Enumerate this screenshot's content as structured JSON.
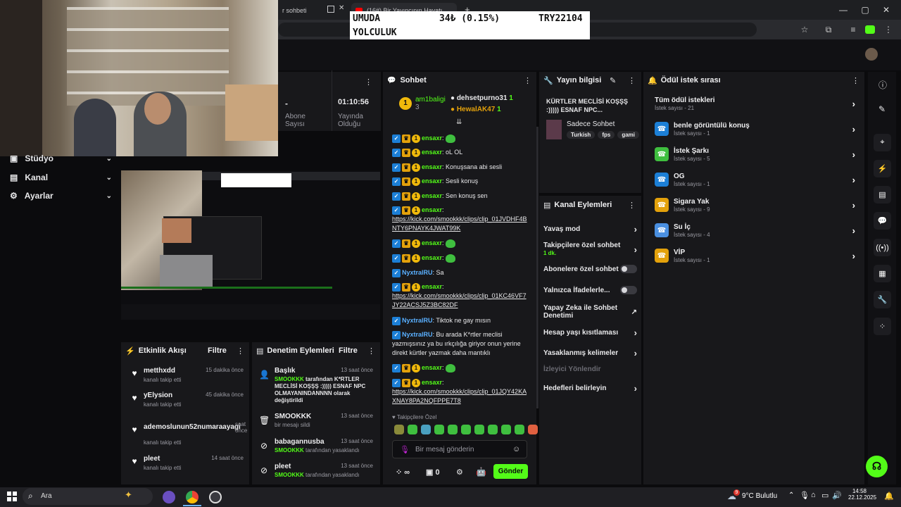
{
  "browser": {
    "tab1_title": "r sohbeti",
    "tab2_title": "(16#) Bir Yayıncının Hayatı",
    "new_tab": "+",
    "min": "—",
    "max": "▢",
    "close": "✕"
  },
  "ticker": {
    "name_line1": "UMUDA",
    "name_line2": "YOLCULUK",
    "change": "34₺ (0.15%)",
    "price": "TRY22104"
  },
  "stats": {
    "subs_value": "-",
    "subs_label_1": "Abone",
    "subs_label_2": "Sayısı",
    "uptime_value": "01:10:56",
    "uptime_label_1": "Yayında",
    "uptime_label_2": "Olduğu"
  },
  "nav": {
    "items": [
      {
        "label": "Stüdyo"
      },
      {
        "label": "Kanal"
      },
      {
        "label": "Ayarlar"
      }
    ]
  },
  "chat": {
    "title": "Sohbet",
    "top": {
      "user1": "am1baligi",
      "user1_count": "3",
      "user2": "dehsetpurno31",
      "user2_count": "1",
      "user3": "HewalAK47",
      "user3_count": "1",
      "rank": "1"
    },
    "lines": [
      {
        "user": "ensaxr",
        "text": ""
      },
      {
        "user": "ensaxr",
        "text": "oL OL"
      },
      {
        "user": "ensaxr",
        "text": "Konuşsana abi sesli"
      },
      {
        "user": "ensaxr",
        "text": "Sesli konuş"
      },
      {
        "user": "ensaxr",
        "text": "Sen konuş sen"
      },
      {
        "user": "ensaxr",
        "text": "https://kick.com/smookkk/clips/clip_01JVDHF4BNTY6PNAYK4JWAT99K"
      },
      {
        "user": "ensaxr",
        "text": ""
      },
      {
        "user": "ensaxr",
        "text": ""
      },
      {
        "user": "NyxtralRU",
        "text": "Sa"
      },
      {
        "user": "ensaxr",
        "text": "https://kick.com/smookkk/clips/clip_01KC46VF7JY22ACSJ5Z3BC82DF"
      },
      {
        "user": "NyxtralRU",
        "text": "Tiktok ne gay mısın"
      },
      {
        "user": "NyxtralRU",
        "text": "Bu arada K*rtler meclisi yazmışsınız ya bu ırkçılığa giriyor onun yerine direkt kürtler yazmak daha mantıklı"
      },
      {
        "user": "ensaxr",
        "text": ""
      },
      {
        "user": "ensaxr",
        "text": "https://kick.com/smookkk/clips/clip_01JQY42KAXNAY8PA2NQFPPE7T8"
      }
    ],
    "followers_only": "Takipçilere Özel",
    "input_placeholder": "Bir mesaj gönderin",
    "infinity": "∞",
    "count": "0",
    "send": "Gönder"
  },
  "stream_info": {
    "title": "Yayın bilgisi",
    "stream_title": "KÜRTLER MECLİSİ KOŞŞŞ :))))) ESNAF NPC...",
    "category": "Sadece Sohbet",
    "tags": [
      "Turkish",
      "fps",
      "gami"
    ]
  },
  "channel_actions": {
    "title": "Kanal Eylemleri",
    "items": [
      {
        "label": "Yavaş mod",
        "control": "chevron"
      },
      {
        "label": "Takipçilere özel sohbet",
        "sub": "1 dk.",
        "control": "chevron"
      },
      {
        "label": "Abonelere özel sohbet",
        "control": "toggle"
      },
      {
        "label": "Yalnızca İfadelerle...",
        "control": "toggle"
      },
      {
        "label": "Yapay Zeka ile Sohbet Denetimi",
        "control": "external"
      },
      {
        "label": "Hesap yaşı kısıtlaması",
        "control": "chevron"
      },
      {
        "label": "Yasaklanmış kelimeler",
        "control": "chevron"
      },
      {
        "label": "İzleyici Yönlendir",
        "control": "none"
      },
      {
        "label": "Hedefleri belirleyin",
        "control": "chevron"
      }
    ]
  },
  "rewards": {
    "title": "Ödül istek sırası",
    "all_label": "Tüm ödül istekleri",
    "all_count": "İstek sayısı - 21",
    "items": [
      {
        "label": "benle görüntülü konuş",
        "count": "İstek sayısı - 1",
        "color": "#1c7fd6"
      },
      {
        "label": "İstek Şarkı",
        "count": "İstek sayısı - 5",
        "color": "#3fbf3f"
      },
      {
        "label": "OG",
        "count": "İstek sayısı - 1",
        "color": "#1c7fd6"
      },
      {
        "label": "Sigara Yak",
        "count": "İstek sayısı - 9",
        "color": "#e3a10b"
      },
      {
        "label": "Su İç",
        "count": "İstek sayısı - 4",
        "color": "#4a8fe0"
      },
      {
        "label": "VİP",
        "count": "İstek sayısı - 1",
        "color": "#e3a10b"
      }
    ]
  },
  "activity": {
    "title": "Etkinlik Akışı",
    "filter": "Filtre",
    "items": [
      {
        "user": "metthxdd",
        "time": "15 dakika önce",
        "action": "kanalı takip etti"
      },
      {
        "user": "yElysion",
        "time": "45 dakika önce",
        "action": "kanalı takip etti"
      },
      {
        "user": "ademoslunun52numaraayagi",
        "time": "saat önce",
        "action": "kanalı takip etti"
      },
      {
        "user": "pleet",
        "time": "14 saat önce",
        "action": "kanalı takip etti"
      }
    ]
  },
  "moderation": {
    "title": "Denetim Eylemleri",
    "filter": "Filtre",
    "items": [
      {
        "head": "Başlık",
        "time": "13 saat önce",
        "line1_user": "SMOOKKK",
        "line1": "tarafından K*RTLER MECLİSİ KOŞŞŞ :))))) ESNAF NPC OLMAYANINDANNNN olarak değiştirildi"
      },
      {
        "head": "SMOOKKK",
        "time": "13 saat önce",
        "line1_user": "",
        "line1": "bir mesajı sildi"
      },
      {
        "head": "babagannusba",
        "time": "13 saat önce",
        "line1_user": "SMOOKKK",
        "line1": "tarafından yasaklandı"
      },
      {
        "head": "pleet",
        "time": "13 saat önce",
        "line1_user": "SMOOKKK",
        "line1": "tarafından yasaklandı"
      }
    ]
  },
  "taskbar": {
    "search": "Ara",
    "weather_temp": "9°C",
    "weather_text": "Bulutlu",
    "time": "14:58",
    "date": "22.12.2025",
    "weather_badge": "9"
  },
  "colors": {
    "accent": "#53fc18",
    "panel": "#18181b",
    "bg": "#0b0b0d"
  }
}
